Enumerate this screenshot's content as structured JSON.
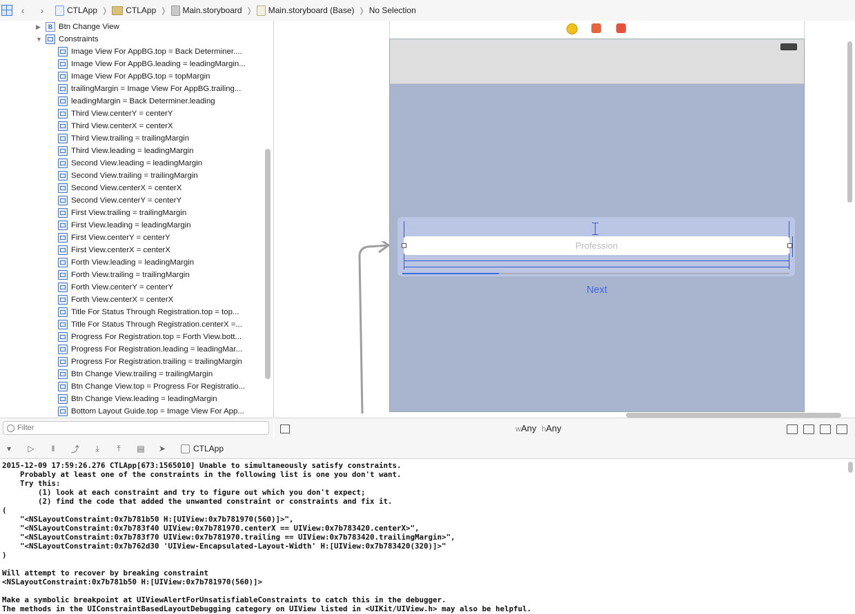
{
  "jumpbar": {
    "crumbs": [
      "CTLApp",
      "CTLApp",
      "Main.storyboard",
      "Main.storyboard (Base)",
      "No Selection"
    ]
  },
  "navigator": {
    "rows": [
      "Btn Change View",
      "Constraints",
      "Image View For AppBG.top = Back Determiner....",
      "Image View For AppBG.leading = leadingMargin...",
      "Image View For AppBG.top = topMargin",
      "trailingMargin = Image View For AppBG.trailing...",
      "leadingMargin = Back Determiner.leading",
      "Third View.centerY = centerY",
      "Third View.centerX = centerX",
      "Third View.trailing = trailingMargin",
      "Third View.leading = leadingMargin",
      "Second View.leading = leadingMargin",
      "Second View.trailing = trailingMargin",
      "Second View.centerX = centerX",
      "Second View.centerY = centerY",
      "First View.trailing = trailingMargin",
      "First View.leading = leadingMargin",
      "First View.centerY = centerY",
      "First View.centerX = centerX",
      "Forth View.leading = leadingMargin",
      "Forth View.trailing = trailingMargin",
      "Forth View.centerY = centerY",
      "Forth View.centerX = centerX",
      "Title For Status Through Registration.top = top...",
      "Title For Status Through Registration.centerX =...",
      "Progress For Registration.top = Forth View.bott...",
      "Progress For Registration.leading = leadingMar...",
      "Progress For Registration.trailing = trailingMargin",
      "Btn Change View.trailing = trailingMargin",
      "Btn Change View.top = Progress For Registratio...",
      "Btn Change View.leading = leadingMargin",
      "Bottom Layout Guide.top = Image View For App..."
    ],
    "filter_placeholder": "Filter"
  },
  "canvas": {
    "textfield_placeholder": "Profession",
    "next_label": "Next",
    "progress_fraction": 0.25
  },
  "sizebar": {
    "w_prefix": "w",
    "w_value": "Any",
    "h_prefix": "h",
    "h_value": "Any"
  },
  "debugbar": {
    "target": "CTLApp"
  },
  "console": {
    "text": "2015-12-09 17:59:26.276 CTLApp[673:1565010] Unable to simultaneously satisfy constraints.\n    Probably at least one of the constraints in the following list is one you don't want.\n    Try this:\n        (1) look at each constraint and try to figure out which you don't expect;\n        (2) find the code that added the unwanted constraint or constraints and fix it.\n(\n    \"<NSLayoutConstraint:0x7b781b50 H:[UIView:0x7b781970(560)]>\",\n    \"<NSLayoutConstraint:0x7b783f40 UIView:0x7b781970.centerX == UIView:0x7b783420.centerX>\",\n    \"<NSLayoutConstraint:0x7b783f70 UIView:0x7b781970.trailing == UIView:0x7b783420.trailingMargin>\",\n    \"<NSLayoutConstraint:0x7b762d30 'UIView-Encapsulated-Layout-Width' H:[UIView:0x7b783420(320)]>\"\n)\n\nWill attempt to recover by breaking constraint\n<NSLayoutConstraint:0x7b781b50 H:[UIView:0x7b781970(560)]>\n\nMake a symbolic breakpoint at UIViewAlertForUnsatisfiableConstraints to catch this in the debugger.\nThe methods in the UIConstraintBasedLayoutDebugging category on UIView listed in <UIKit/UIView.h> may also be helpful."
  }
}
